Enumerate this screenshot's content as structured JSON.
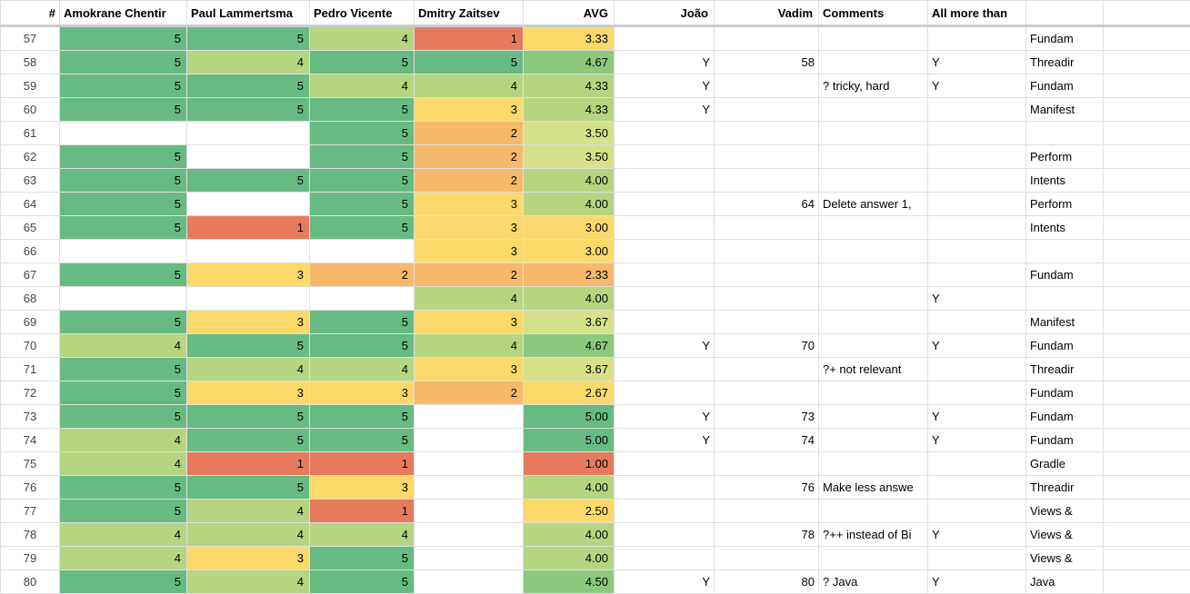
{
  "headers": {
    "hash": "#",
    "r1": "Amokrane Chentir",
    "r2": "Paul Lammertsma",
    "r3": "Pedro Vicente",
    "r4": "Dmitry Zaitsev",
    "avg": "AVG",
    "joao": "João",
    "vadim": "Vadim",
    "comments": "Comments",
    "allmore": "All more than",
    "category": ""
  },
  "rows": [
    {
      "id": "57",
      "r1": 5,
      "r2": 5,
      "r3": 4,
      "r4": 1,
      "avg": "3.33",
      "joao": "",
      "vadim": "",
      "comments": "",
      "allmore": "",
      "category": "Fundam"
    },
    {
      "id": "58",
      "r1": 5,
      "r2": 4,
      "r3": 5,
      "r4": 5,
      "avg": "4.67",
      "joao": "Y",
      "vadim": "58",
      "comments": "",
      "allmore": "Y",
      "category": "Threadir"
    },
    {
      "id": "59",
      "r1": 5,
      "r2": 5,
      "r3": 4,
      "r4": 4,
      "avg": "4.33",
      "joao": "Y",
      "vadim": "",
      "comments": "? tricky, hard",
      "allmore": "Y",
      "category": "Fundam"
    },
    {
      "id": "60",
      "r1": 5,
      "r2": 5,
      "r3": 5,
      "r4": 3,
      "avg": "4.33",
      "joao": "Y",
      "vadim": "",
      "comments": "",
      "allmore": "",
      "category": "Manifest"
    },
    {
      "id": "61",
      "r1": null,
      "r2": null,
      "r3": 5,
      "r4": 2,
      "avg": "3.50",
      "joao": "",
      "vadim": "",
      "comments": "",
      "allmore": "",
      "category": ""
    },
    {
      "id": "62",
      "r1": 5,
      "r2": null,
      "r3": 5,
      "r4": 2,
      "avg": "3.50",
      "joao": "",
      "vadim": "",
      "comments": "",
      "allmore": "",
      "category": "Perform"
    },
    {
      "id": "63",
      "r1": 5,
      "r2": 5,
      "r3": 5,
      "r4": 2,
      "avg": "4.00",
      "joao": "",
      "vadim": "",
      "comments": "",
      "allmore": "",
      "category": "Intents"
    },
    {
      "id": "64",
      "r1": 5,
      "r2": null,
      "r3": 5,
      "r4": 3,
      "avg": "4.00",
      "joao": "",
      "vadim": "64",
      "comments": "Delete answer 1,",
      "allmore": "",
      "category": "Perform"
    },
    {
      "id": "65",
      "r1": 5,
      "r2": 1,
      "r3": 5,
      "r4": 3,
      "avg": "3.00",
      "joao": "",
      "vadim": "",
      "comments": "",
      "allmore": "",
      "category": "Intents"
    },
    {
      "id": "66",
      "r1": null,
      "r2": null,
      "r3": null,
      "r4": 3,
      "avg": "3.00",
      "joao": "",
      "vadim": "",
      "comments": "",
      "allmore": "",
      "category": ""
    },
    {
      "id": "67",
      "r1": 5,
      "r2": 3,
      "r3": 2,
      "r4": 2,
      "avg": "2.33",
      "joao": "",
      "vadim": "",
      "comments": "",
      "allmore": "",
      "category": "Fundam"
    },
    {
      "id": "68",
      "r1": null,
      "r2": null,
      "r3": null,
      "r4": 4,
      "avg": "4.00",
      "joao": "",
      "vadim": "",
      "comments": "",
      "allmore": "Y",
      "category": ""
    },
    {
      "id": "69",
      "r1": 5,
      "r2": 3,
      "r3": 5,
      "r4": 3,
      "avg": "3.67",
      "joao": "",
      "vadim": "",
      "comments": "",
      "allmore": "",
      "category": "Manifest"
    },
    {
      "id": "70",
      "r1": 4,
      "r2": 5,
      "r3": 5,
      "r4": 4,
      "avg": "4.67",
      "joao": "Y",
      "vadim": "70",
      "comments": "",
      "allmore": "Y",
      "category": "Fundam"
    },
    {
      "id": "71",
      "r1": 5,
      "r2": 4,
      "r3": 4,
      "r4": 3,
      "avg": "3.67",
      "joao": "",
      "vadim": "",
      "comments": "?+ not relevant",
      "allmore": "",
      "category": "Threadir"
    },
    {
      "id": "72",
      "r1": 5,
      "r2": 3,
      "r3": 3,
      "r4": 2,
      "avg": "2.67",
      "joao": "",
      "vadim": "",
      "comments": "",
      "allmore": "",
      "category": "Fundam"
    },
    {
      "id": "73",
      "r1": 5,
      "r2": 5,
      "r3": 5,
      "r4": null,
      "avg": "5.00",
      "joao": "Y",
      "vadim": "73",
      "comments": "",
      "allmore": "Y",
      "category": "Fundam"
    },
    {
      "id": "74",
      "r1": 4,
      "r2": 5,
      "r3": 5,
      "r4": null,
      "avg": "5.00",
      "joao": "Y",
      "vadim": "74",
      "comments": "",
      "allmore": "Y",
      "category": "Fundam"
    },
    {
      "id": "75",
      "r1": 4,
      "r2": 1,
      "r3": 1,
      "r4": null,
      "avg": "1.00",
      "joao": "",
      "vadim": "",
      "comments": "",
      "allmore": "",
      "category": "Gradle"
    },
    {
      "id": "76",
      "r1": 5,
      "r2": 5,
      "r3": 3,
      "r4": null,
      "avg": "4.00",
      "joao": "",
      "vadim": "76",
      "comments": "Make less answe",
      "allmore": "",
      "category": "Threadir"
    },
    {
      "id": "77",
      "r1": 5,
      "r2": 4,
      "r3": 1,
      "r4": null,
      "avg": "2.50",
      "joao": "",
      "vadim": "",
      "comments": "",
      "allmore": "",
      "category": "Views &"
    },
    {
      "id": "78",
      "r1": 4,
      "r2": 4,
      "r3": 4,
      "r4": null,
      "avg": "4.00",
      "joao": "",
      "vadim": "78",
      "comments": "?++ instead of Bi",
      "allmore": "Y",
      "category": "Views &"
    },
    {
      "id": "79",
      "r1": 4,
      "r2": 3,
      "r3": 5,
      "r4": null,
      "avg": "4.00",
      "joao": "",
      "vadim": "",
      "comments": "",
      "allmore": "",
      "category": "Views &"
    },
    {
      "id": "80",
      "r1": 5,
      "r2": 4,
      "r3": 5,
      "r4": null,
      "avg": "4.50",
      "joao": "Y",
      "vadim": "80",
      "comments": "? Java",
      "allmore": "Y",
      "category": "Java"
    }
  ],
  "chart_data": {
    "type": "table",
    "colorScale": {
      "1": "#e77a5c",
      "2": "#f6b96a",
      "3": "#fcd96a",
      "4": "#b6d581",
      "5": "#67bb82"
    }
  }
}
